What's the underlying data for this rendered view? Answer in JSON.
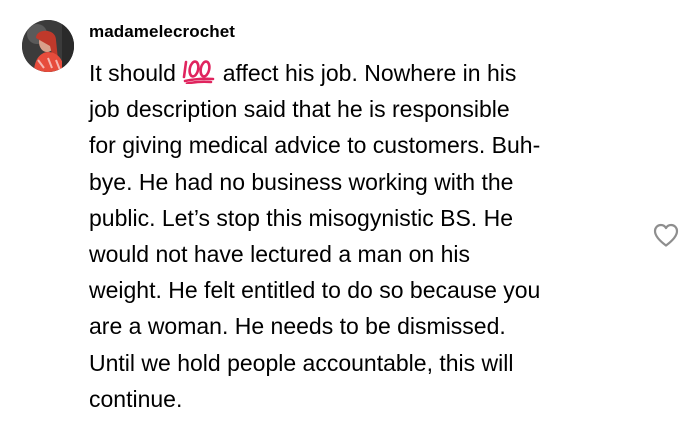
{
  "comment": {
    "username": "madamelecrochet",
    "text_lead": "It should ",
    "emoji": "💯",
    "text_rest": " affect his job. Nowhere in his\njob description said that he is responsible\nfor giving medical advice to customers. Buh-\nbye. He had no business working with the\npublic. Let’s stop this misogynistic BS. He\nwould not have lectured a man on his\nweight. He felt entitled to do so because you\nare a woman. He needs to be dismissed.\nUntil we hold people accountable, this will\ncontinue."
  },
  "icons": {
    "avatar": "user-avatar",
    "hundred": "hundred-points-icon",
    "like": "heart-outline-icon"
  },
  "colors": {
    "text": "#000000",
    "emoji_red": "#e0245e",
    "icon_stroke": "#8e8e8e"
  }
}
